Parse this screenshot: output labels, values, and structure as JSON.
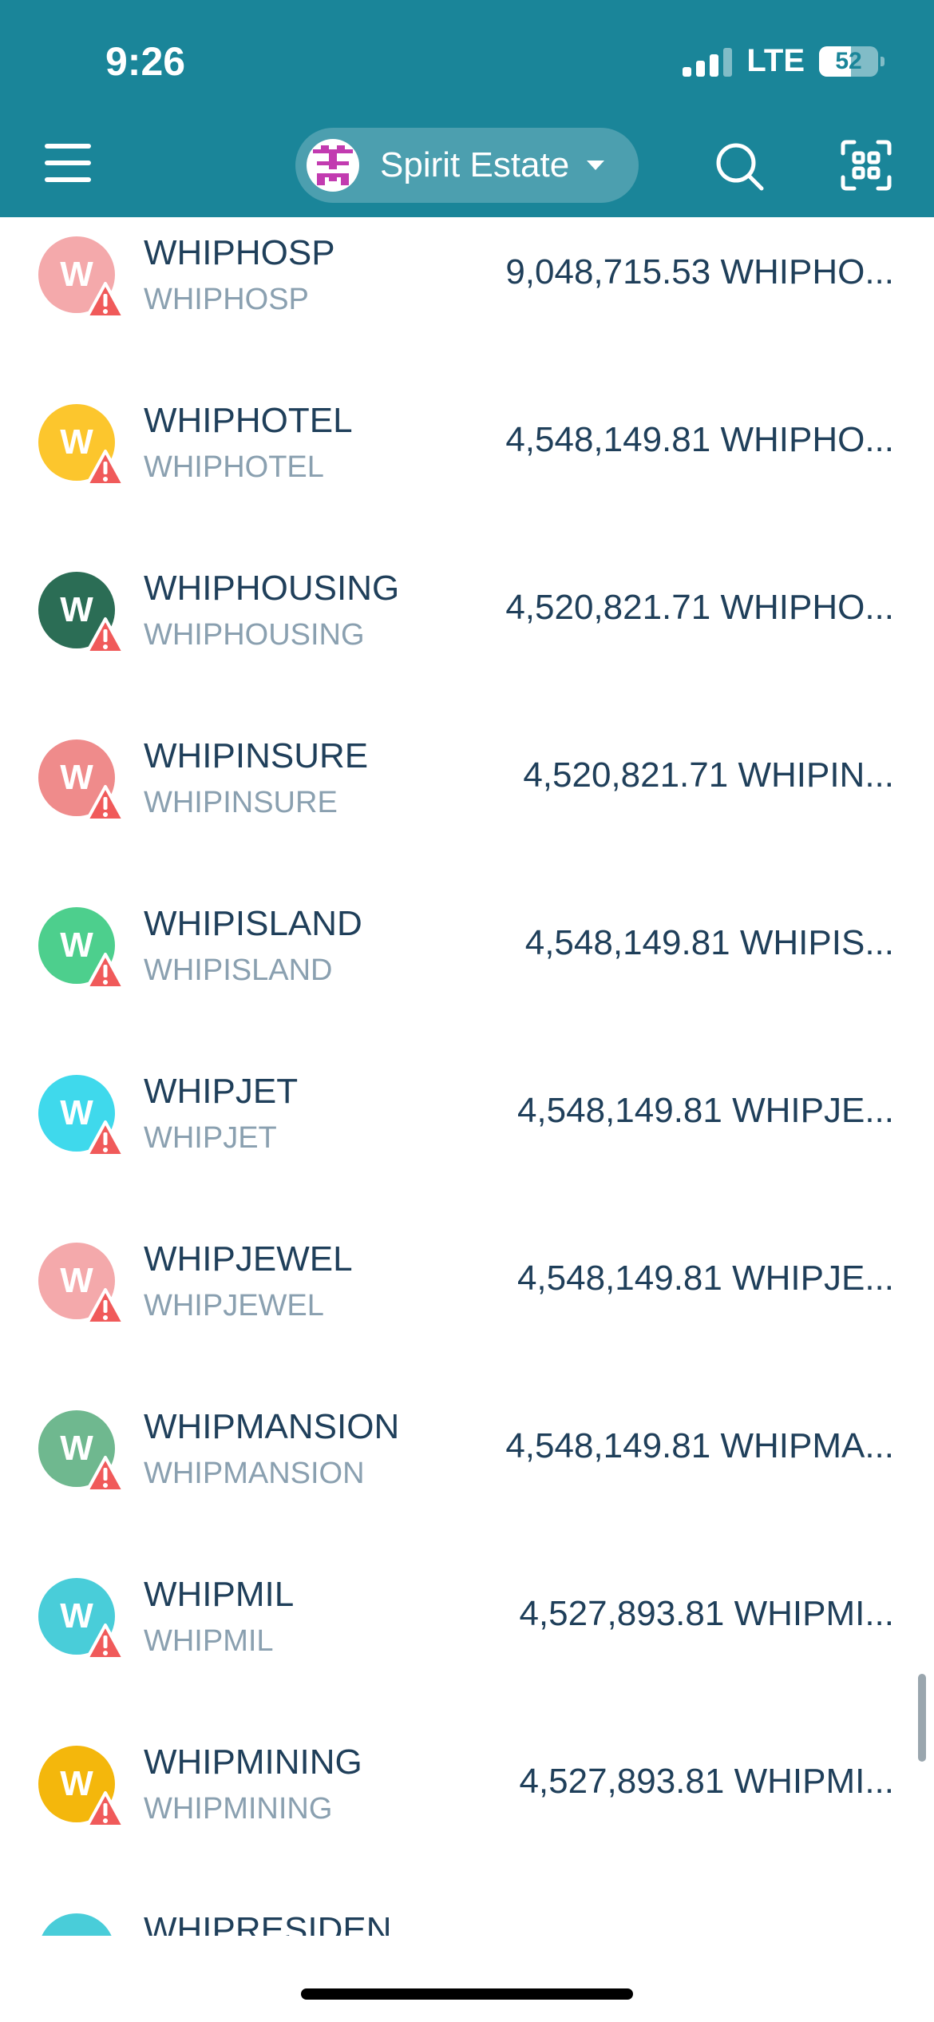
{
  "status_bar": {
    "time": "9:26",
    "network": "LTE",
    "battery": "52"
  },
  "header": {
    "account_name": "Spirit Estate",
    "icons": {
      "menu": "hamburger-menu-icon",
      "search": "search-icon",
      "scan": "qr-scan-icon",
      "account": "account-identicon"
    }
  },
  "tokens": [
    {
      "symbol": "WHIPHOSP",
      "name": "WHIPHOSP",
      "balance": "9,048,715.53 WHIPHO...",
      "letter": "W",
      "color": "#f4a9ab"
    },
    {
      "symbol": "WHIPHOTEL",
      "name": "WHIPHOTEL",
      "balance": "4,548,149.81 WHIPHO...",
      "letter": "W",
      "color": "#fcc62d"
    },
    {
      "symbol": "WHIPHOUSING",
      "name": "WHIPHOUSING",
      "balance": "4,520,821.71 WHIPHO...",
      "letter": "W",
      "color": "#2b6d55"
    },
    {
      "symbol": "WHIPINSURE",
      "name": "WHIPINSURE",
      "balance": "4,520,821.71 WHIPIN...",
      "letter": "W",
      "color": "#ef8b8b"
    },
    {
      "symbol": "WHIPISLAND",
      "name": "WHIPISLAND",
      "balance": "4,548,149.81 WHIPIS...",
      "letter": "W",
      "color": "#4dcf8d"
    },
    {
      "symbol": "WHIPJET",
      "name": "WHIPJET",
      "balance": "4,548,149.81 WHIPJE...",
      "letter": "W",
      "color": "#3fd9ec"
    },
    {
      "symbol": "WHIPJEWEL",
      "name": "WHIPJEWEL",
      "balance": "4,548,149.81 WHIPJE...",
      "letter": "W",
      "color": "#f4a9ab"
    },
    {
      "symbol": "WHIPMANSION",
      "name": "WHIPMANSION",
      "balance": "4,548,149.81 WHIPMA...",
      "letter": "W",
      "color": "#6fb88f"
    },
    {
      "symbol": "WHIPMIL",
      "name": "WHIPMIL",
      "balance": "4,527,893.81 WHIPMI...",
      "letter": "W",
      "color": "#49cdd9"
    },
    {
      "symbol": "WHIPMINING",
      "name": "WHIPMINING",
      "balance": "4,527,893.81 WHIPMI...",
      "letter": "W",
      "color": "#f4b70c"
    },
    {
      "symbol": "WHIPRESIDEN",
      "name": "",
      "balance": "",
      "letter": "",
      "color": "#49cdd9"
    }
  ],
  "colors": {
    "header_bg": "#1a8599",
    "warning": "#f05a5a",
    "text_primary": "#1f3f5a",
    "text_secondary": "#8aa0b0"
  }
}
